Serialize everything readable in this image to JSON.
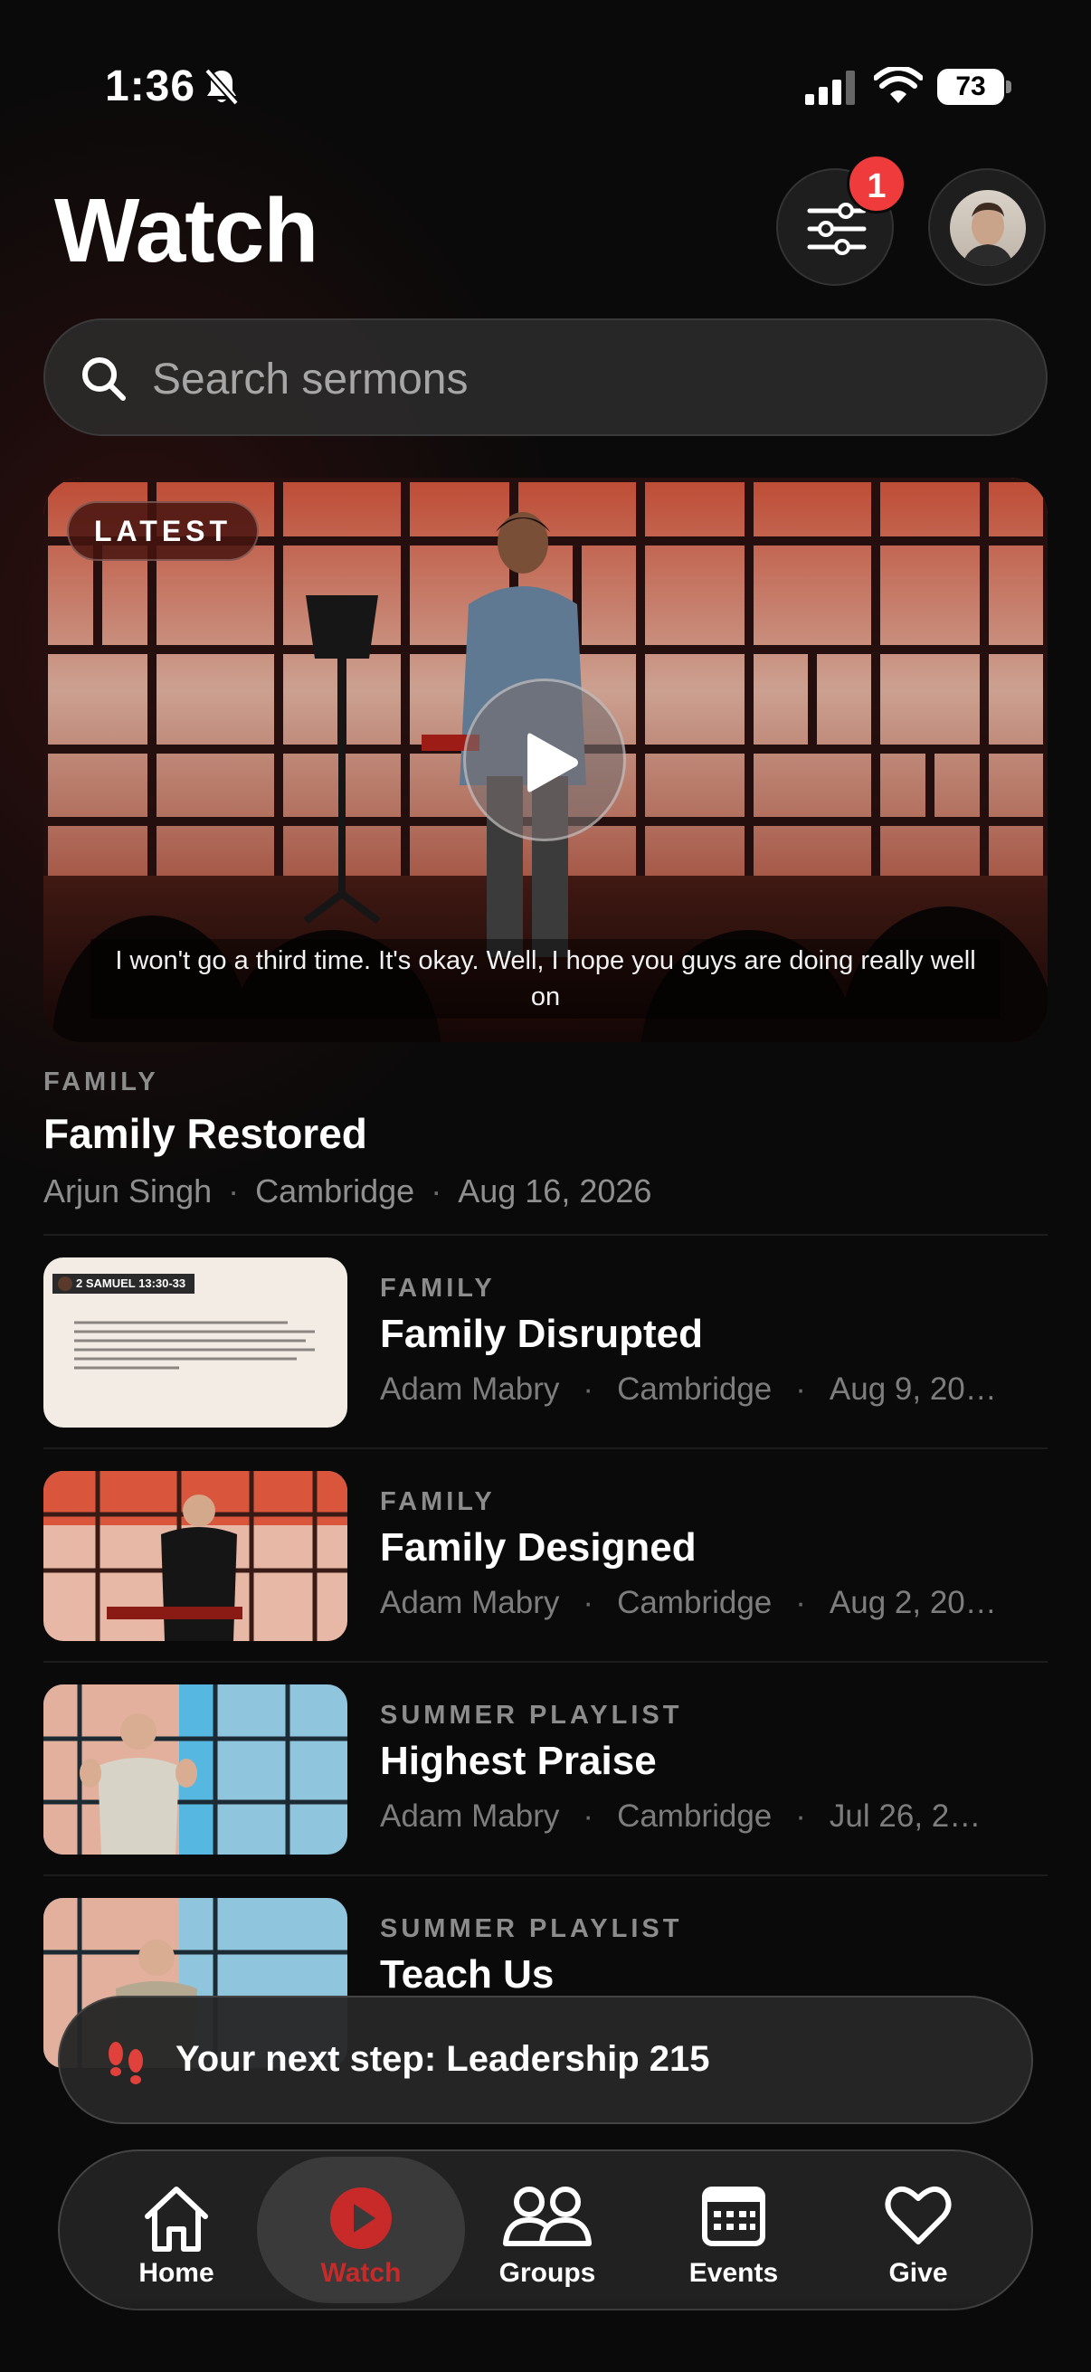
{
  "status_bar": {
    "time": "1:36",
    "battery": "73"
  },
  "header": {
    "title": "Watch",
    "filter_badge": "1"
  },
  "search": {
    "placeholder": "Search sermons"
  },
  "hero": {
    "pill": "LATEST",
    "caption": "I won't go a third time. It's okay. Well, I hope you guys are doing really well on",
    "category": "FAMILY",
    "title": "Family Restored",
    "speaker": "Arjun Singh",
    "campus": "Cambridge",
    "date": "Aug 16, 2026"
  },
  "sermons": [
    {
      "category": "FAMILY",
      "title": "Family Disrupted",
      "speaker": "Adam Mabry",
      "campus": "Cambridge",
      "date": "Aug 9, 20…",
      "thumb_heading": "2 SAMUEL 13:30-33"
    },
    {
      "category": "FAMILY",
      "title": "Family Designed",
      "speaker": "Adam Mabry",
      "campus": "Cambridge",
      "date": "Aug 2, 20…"
    },
    {
      "category": "SUMMER PLAYLIST",
      "title": "Highest Praise",
      "speaker": "Adam Mabry",
      "campus": "Cambridge",
      "date": "Jul 26, 2…"
    },
    {
      "category": "SUMMER PLAYLIST",
      "title": "Teach Us"
    }
  ],
  "next_step": {
    "text": "Your next step: Leadership 215"
  },
  "tabs": [
    {
      "label": "Home",
      "icon": "home-icon"
    },
    {
      "label": "Watch",
      "icon": "play-circle-icon",
      "active": true
    },
    {
      "label": "Groups",
      "icon": "people-icon"
    },
    {
      "label": "Events",
      "icon": "calendar-icon"
    },
    {
      "label": "Give",
      "icon": "heart-icon"
    }
  ],
  "colors": {
    "accent": "#c82a2a",
    "badge": "#ef3b3b",
    "background": "#0a0a0a"
  }
}
